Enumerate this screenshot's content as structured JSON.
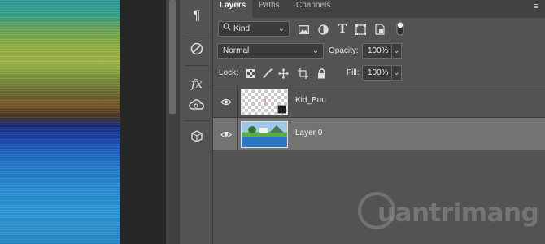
{
  "tabs": [
    {
      "label": "Layers",
      "active": true
    },
    {
      "label": "Paths",
      "active": false
    },
    {
      "label": "Channels",
      "active": false
    }
  ],
  "panel_menu_icon": "hamburger-icon",
  "filter": {
    "label": "Kind",
    "icon": "search-icon"
  },
  "filter_icons": [
    "image-filter-icon",
    "adjustment-filter-icon",
    "type-filter-icon",
    "shape-filter-icon",
    "smart-object-filter-icon",
    "filter-toggle-icon"
  ],
  "blend": {
    "mode": "Normal",
    "opacity_label": "Opacity:",
    "opacity_value": "100%"
  },
  "lock": {
    "label": "Lock:",
    "icons": [
      "lock-transparent-icon",
      "lock-image-icon",
      "lock-position-icon",
      "lock-artboard-icon",
      "lock-all-icon"
    ],
    "fill_label": "Fill:",
    "fill_value": "100%"
  },
  "layers": [
    {
      "name": "Kid_Buu",
      "thumbnail": "transparent-smart-object",
      "visible": true,
      "selected": false
    },
    {
      "name": "Layer 0",
      "thumbnail": "landscape-image",
      "visible": true,
      "selected": true
    }
  ],
  "iconbar": [
    "paragraph-icon",
    "adjustments-icon",
    "styles-fx-icon",
    "creative-cloud-libraries-icon",
    "3d-icon"
  ],
  "watermark": {
    "text": "uantrimang"
  },
  "colors": {
    "panel_bg": "#535353",
    "tab_bar": "#424242",
    "selected_row": "#737373",
    "field_bg": "#3b3b3b"
  }
}
